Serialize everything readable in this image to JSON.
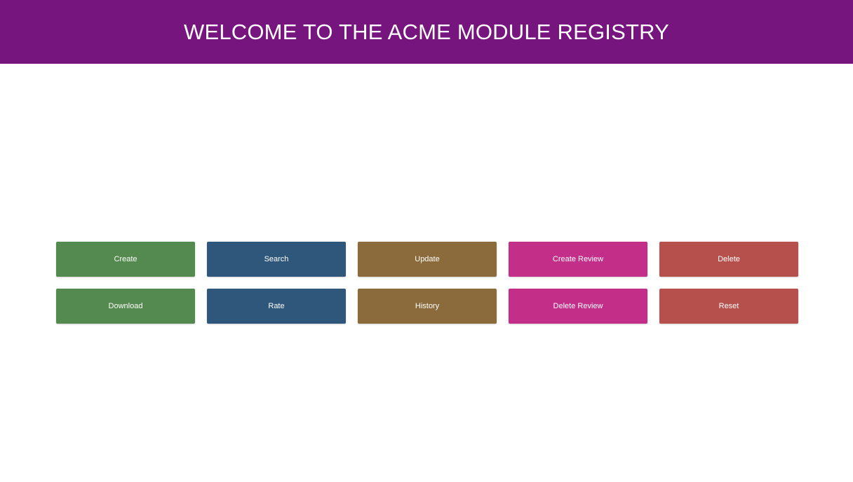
{
  "header": {
    "title": "WELCOME TO THE ACME MODULE REGISTRY",
    "background": "#76157d"
  },
  "buttons": [
    {
      "label": "Create",
      "color": "#548a4f"
    },
    {
      "label": "Search",
      "color": "#2f577b"
    },
    {
      "label": "Update",
      "color": "#8b6b3b"
    },
    {
      "label": "Create Review",
      "color": "#c22e88"
    },
    {
      "label": "Delete",
      "color": "#b6504c"
    },
    {
      "label": "Download",
      "color": "#548a4f"
    },
    {
      "label": "Rate",
      "color": "#2f577b"
    },
    {
      "label": "History",
      "color": "#8b6b3b"
    },
    {
      "label": "Delete Review",
      "color": "#c22e88"
    },
    {
      "label": "Reset",
      "color": "#b6504c"
    }
  ]
}
